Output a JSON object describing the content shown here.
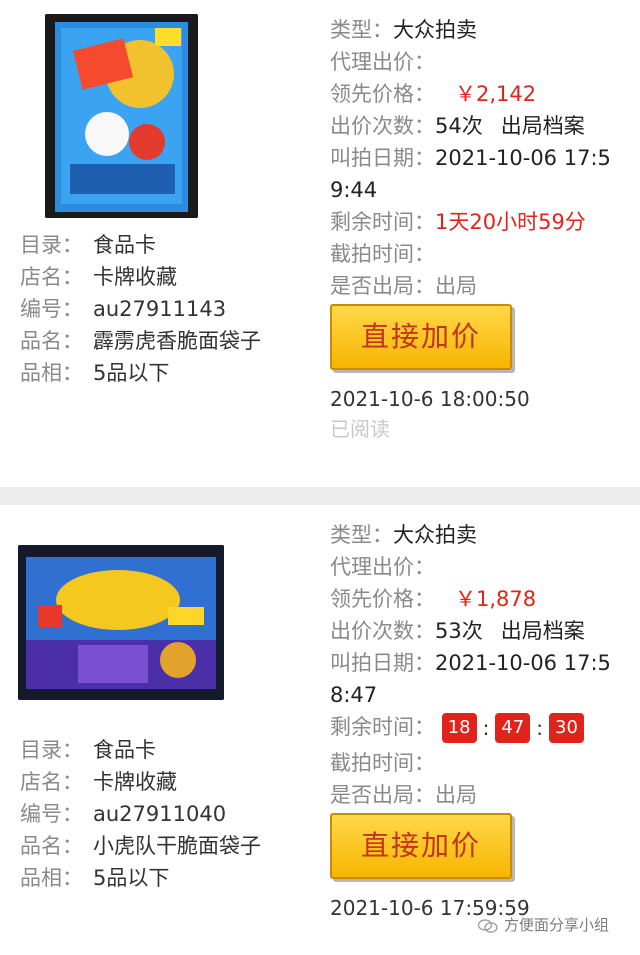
{
  "listings": [
    {
      "left": {
        "catalog_label": "目录：",
        "catalog_value": "食品卡",
        "shop_label": "店名：",
        "shop_value": "卡牌收藏",
        "id_label": "编号：",
        "id_value": "au27911143",
        "name_label": "品名：",
        "name_value": "霹雳虎香脆面袋子",
        "grade_label": "品相：",
        "grade_value": "5品以下"
      },
      "right": {
        "type_label": "类型：",
        "type_value": "大众拍卖",
        "agent_label": "代理出价：",
        "lead_label": "领先价格：",
        "lead_value": "￥2,142",
        "bids_label": "出价次数：",
        "bids_value": "54次",
        "archive": "出局档案",
        "date_label": "叫拍日期：",
        "date_value": "2021-10-06 17:59:44",
        "remain_label": "剩余时间：",
        "remain_value": "1天20小时59分",
        "end_label": "截拍时间：",
        "out_label": "是否出局：",
        "out_value": "出局",
        "button": "直接加价",
        "timestamp": "2021-10-6 18:00:50",
        "read": "已阅读"
      }
    },
    {
      "left": {
        "catalog_label": "目录：",
        "catalog_value": "食品卡",
        "shop_label": "店名：",
        "shop_value": "卡牌收藏",
        "id_label": "编号：",
        "id_value": "au27911040",
        "name_label": "品名：",
        "name_value": "小虎队干脆面袋子",
        "grade_label": "品相：",
        "grade_value": "5品以下"
      },
      "right": {
        "type_label": "类型：",
        "type_value": "大众拍卖",
        "agent_label": "代理出价：",
        "lead_label": "领先价格：",
        "lead_value": "￥1,878",
        "bids_label": "出价次数：",
        "bids_value": "53次",
        "archive": "出局档案",
        "date_label": "叫拍日期：",
        "date_value": "2021-10-06 17:58:47",
        "remain_label": "剩余时间：",
        "countdown": {
          "h": "18",
          "m": "47",
          "s": "30",
          "sep": ":"
        },
        "end_label": "截拍时间：",
        "out_label": "是否出局：",
        "out_value": "出局",
        "button": "直接加价",
        "timestamp": "2021-10-6 17:59:59"
      }
    }
  ],
  "watermark": "方便面分享小组",
  "colors": {
    "accent_red": "#e0241b",
    "button_yellow": "#f7b500",
    "divider": "#ededed"
  }
}
